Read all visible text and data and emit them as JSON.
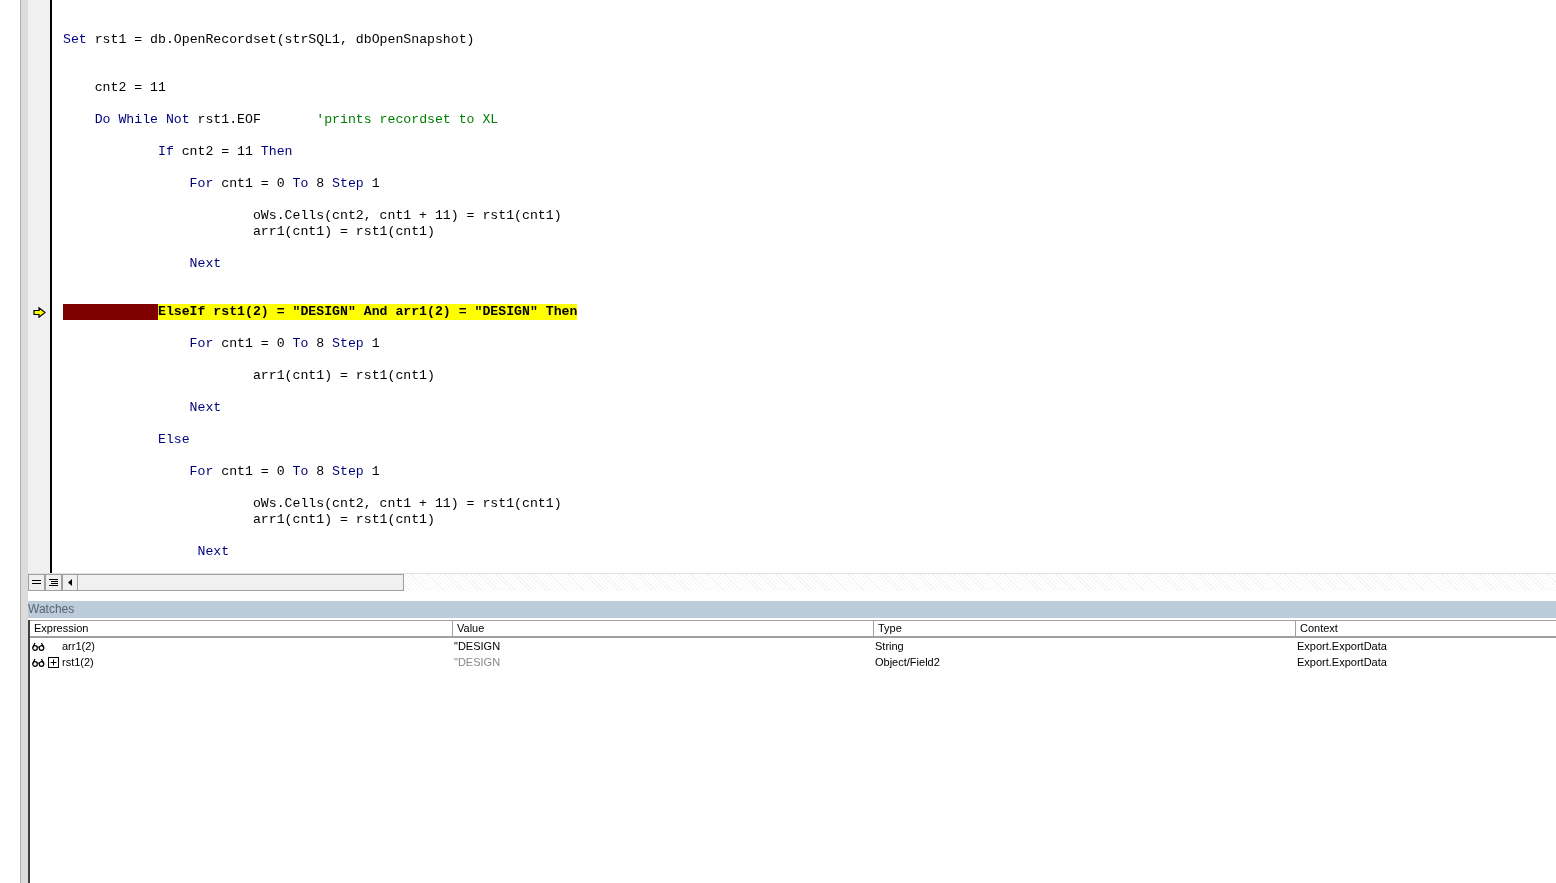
{
  "code_lines": [
    {
      "kind": "blank"
    },
    {
      "kind": "blank"
    },
    {
      "kind": "code",
      "segments": [
        {
          "kind": "keyword",
          "text": "Set"
        },
        {
          "kind": "plain",
          "text": " rst1 = db.OpenRecordset(strSQL1, dbOpenSnapshot)"
        }
      ]
    },
    {
      "kind": "blank"
    },
    {
      "kind": "blank"
    },
    {
      "kind": "code",
      "segments": [
        {
          "kind": "plain",
          "text": "    cnt2 = 11"
        }
      ]
    },
    {
      "kind": "blank"
    },
    {
      "kind": "code",
      "segments": [
        {
          "kind": "keyword",
          "text": "    Do While Not"
        },
        {
          "kind": "plain",
          "text": " rst1.EOF       "
        },
        {
          "kind": "comment",
          "text": "'prints recordset to XL"
        }
      ]
    },
    {
      "kind": "blank"
    },
    {
      "kind": "code",
      "segments": [
        {
          "kind": "keyword",
          "text": "            If"
        },
        {
          "kind": "plain",
          "text": " cnt2 = 11 "
        },
        {
          "kind": "keyword",
          "text": "Then"
        }
      ]
    },
    {
      "kind": "blank"
    },
    {
      "kind": "code",
      "segments": [
        {
          "kind": "keyword",
          "text": "                For"
        },
        {
          "kind": "plain",
          "text": " cnt1 = 0 "
        },
        {
          "kind": "keyword",
          "text": "To"
        },
        {
          "kind": "plain",
          "text": " 8 "
        },
        {
          "kind": "keyword",
          "text": "Step"
        },
        {
          "kind": "plain",
          "text": " 1"
        }
      ]
    },
    {
      "kind": "blank"
    },
    {
      "kind": "code",
      "segments": [
        {
          "kind": "plain",
          "text": "                        oWs.Cells(cnt2, cnt1 + 11) = rst1(cnt1)"
        }
      ]
    },
    {
      "kind": "code",
      "segments": [
        {
          "kind": "plain",
          "text": "                        arr1(cnt1) = rst1(cnt1)"
        }
      ]
    },
    {
      "kind": "blank"
    },
    {
      "kind": "code",
      "segments": [
        {
          "kind": "keyword",
          "text": "                Next"
        }
      ]
    },
    {
      "kind": "blank"
    },
    {
      "kind": "blank"
    },
    {
      "kind": "current",
      "breakpoint": true,
      "text": "            ElseIf rst1(2) = \"DESIGN\" And arr1(2) = \"DESIGN\" Then"
    },
    {
      "kind": "blank"
    },
    {
      "kind": "code",
      "segments": [
        {
          "kind": "keyword",
          "text": "                For"
        },
        {
          "kind": "plain",
          "text": " cnt1 = 0 "
        },
        {
          "kind": "keyword",
          "text": "To"
        },
        {
          "kind": "plain",
          "text": " 8 "
        },
        {
          "kind": "keyword",
          "text": "Step"
        },
        {
          "kind": "plain",
          "text": " 1"
        }
      ]
    },
    {
      "kind": "blank"
    },
    {
      "kind": "code",
      "segments": [
        {
          "kind": "plain",
          "text": "                        arr1(cnt1) = rst1(cnt1)"
        }
      ]
    },
    {
      "kind": "blank"
    },
    {
      "kind": "code",
      "segments": [
        {
          "kind": "keyword",
          "text": "                Next"
        }
      ]
    },
    {
      "kind": "blank"
    },
    {
      "kind": "code",
      "segments": [
        {
          "kind": "keyword",
          "text": "            Else"
        }
      ]
    },
    {
      "kind": "blank"
    },
    {
      "kind": "code",
      "segments": [
        {
          "kind": "keyword",
          "text": "                For"
        },
        {
          "kind": "plain",
          "text": " cnt1 = 0 "
        },
        {
          "kind": "keyword",
          "text": "To"
        },
        {
          "kind": "plain",
          "text": " 8 "
        },
        {
          "kind": "keyword",
          "text": "Step"
        },
        {
          "kind": "plain",
          "text": " 1"
        }
      ]
    },
    {
      "kind": "blank"
    },
    {
      "kind": "code",
      "segments": [
        {
          "kind": "plain",
          "text": "                        oWs.Cells(cnt2, cnt1 + 11) = rst1(cnt1)"
        }
      ]
    },
    {
      "kind": "code",
      "segments": [
        {
          "kind": "plain",
          "text": "                        arr1(cnt1) = rst1(cnt1)"
        }
      ]
    },
    {
      "kind": "blank"
    },
    {
      "kind": "code",
      "segments": [
        {
          "kind": "keyword",
          "text": "                 Next"
        }
      ]
    }
  ],
  "watches": {
    "title": "Watches",
    "columns": [
      "Expression",
      "Value",
      "Type",
      "Context"
    ],
    "rows": [
      {
        "expandable": false,
        "expression": "arr1(2)",
        "value": "\"DESIGN",
        "dimmed": false,
        "type": "String",
        "context": "Export.ExportData"
      },
      {
        "expandable": true,
        "expression": "rst1(2)",
        "value": "\"DESIGN",
        "dimmed": true,
        "type": "Object/Field2",
        "context": "Export.ExportData"
      }
    ]
  }
}
